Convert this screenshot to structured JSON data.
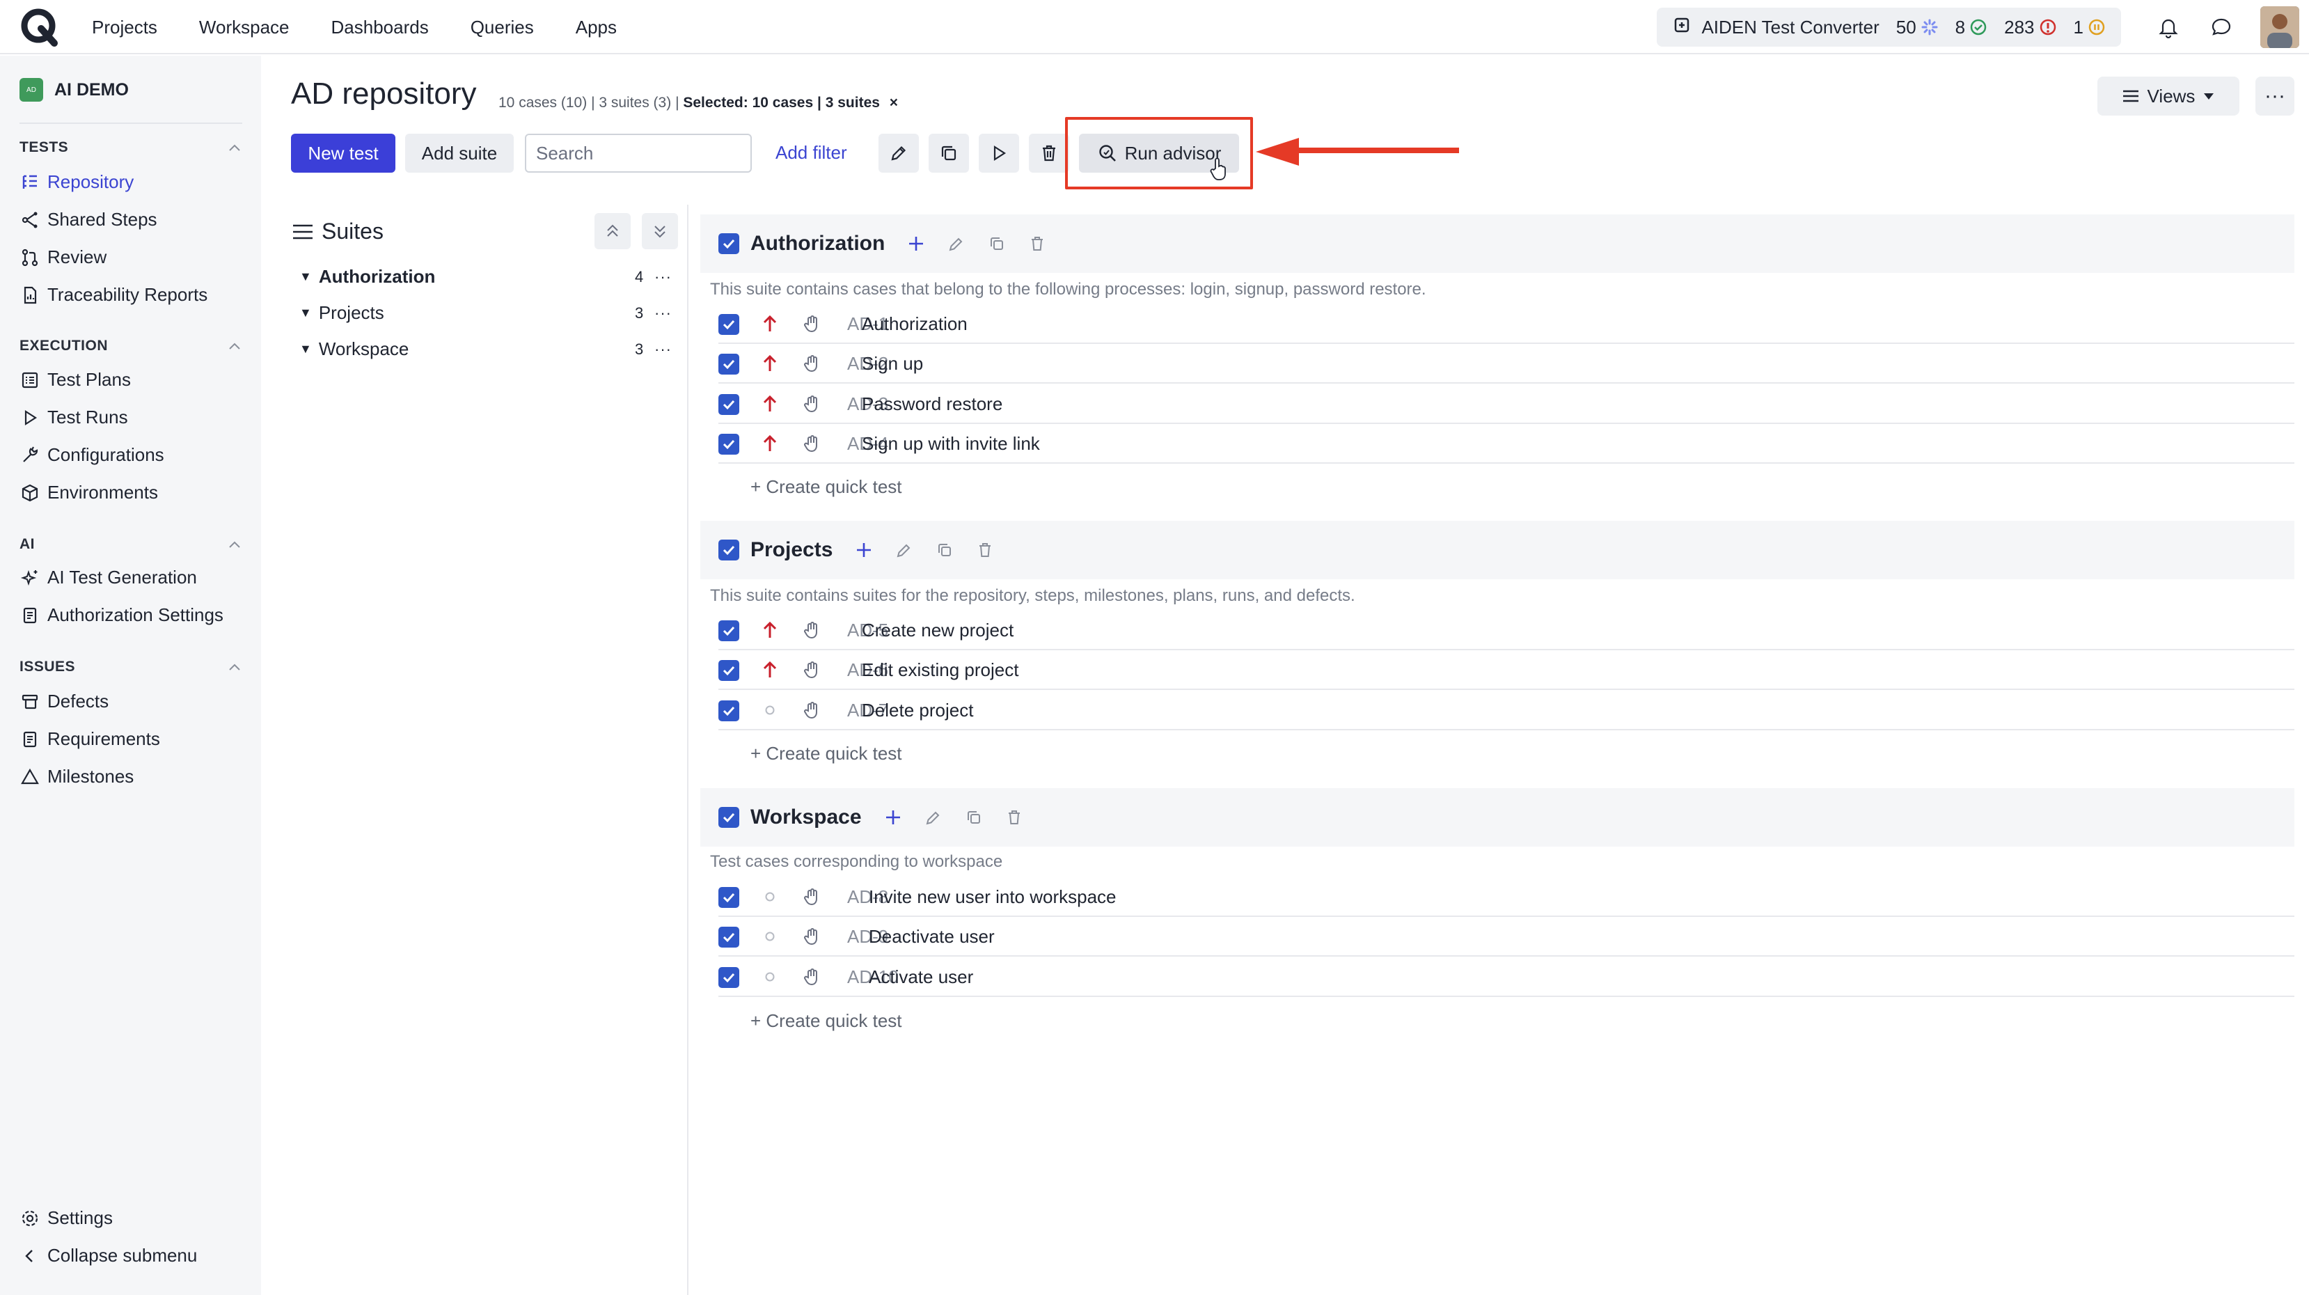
{
  "topbar": {
    "nav": [
      "Projects",
      "Workspace",
      "Dashboards",
      "Queries",
      "Apps"
    ],
    "aiden": {
      "label": "AIDEN Test Converter",
      "stat_pending": "50",
      "stat_passed": "8",
      "stat_failed": "283",
      "stat_paused": "1"
    }
  },
  "sidebar": {
    "project_badge": "AD",
    "project_name": "AI DEMO",
    "sections": {
      "tests": "TESTS",
      "execution": "EXECUTION",
      "ai": "AI",
      "issues": "ISSUES"
    },
    "items": {
      "repository": "Repository",
      "shared_steps": "Shared Steps",
      "review": "Review",
      "traceability": "Traceability Reports",
      "test_plans": "Test Plans",
      "test_runs": "Test Runs",
      "configurations": "Configurations",
      "environments": "Environments",
      "ai_test_generation": "AI Test Generation",
      "authorization_settings": "Authorization Settings",
      "defects": "Defects",
      "requirements": "Requirements",
      "milestones": "Milestones",
      "settings": "Settings",
      "collapse": "Collapse submenu"
    }
  },
  "header": {
    "title": "AD repository",
    "meta_counts": "10 cases (10) | 3 suites (3)",
    "meta_selected": "Selected: 10 cases | 3 suites",
    "meta_clear": "×",
    "views_label": "Views",
    "more_label": "···"
  },
  "toolbar": {
    "new_test": "New test",
    "add_suite": "Add suite",
    "search_placeholder": "Search",
    "add_filter": "Add filter",
    "run_advisor": "Run advisor"
  },
  "tree": {
    "title": "Suites",
    "items": [
      {
        "label": "Authorization",
        "count": "4"
      },
      {
        "label": "Projects",
        "count": "3"
      },
      {
        "label": "Workspace",
        "count": "3"
      }
    ],
    "dots": "···"
  },
  "suites": [
    {
      "name": "Authorization",
      "description": "This suite contains cases that belong to the following processes: login, signup, password restore.",
      "cases": [
        {
          "id": "AD-1",
          "title": "Authorization",
          "priority": "high"
        },
        {
          "id": "AD-2",
          "title": "Sign up",
          "priority": "high"
        },
        {
          "id": "AD-3",
          "title": "Password restore",
          "priority": "high"
        },
        {
          "id": "AD-4",
          "title": "Sign up with invite link",
          "priority": "high"
        }
      ],
      "quick": "+ Create quick test"
    },
    {
      "name": "Projects",
      "description": "This suite contains suites for the repository, steps, milestones, plans, runs, and defects.",
      "cases": [
        {
          "id": "AD-5",
          "title": "Create new project",
          "priority": "high"
        },
        {
          "id": "AD-6",
          "title": "Edit existing project",
          "priority": "high"
        },
        {
          "id": "AD-7",
          "title": "Delete project",
          "priority": "none"
        }
      ],
      "quick": "+ Create quick test"
    },
    {
      "name": "Workspace",
      "description": "Test cases corresponding to workspace",
      "cases": [
        {
          "id": "AD-8",
          "title": "Invite new user into workspace",
          "priority": "none"
        },
        {
          "id": "AD-9",
          "title": "Deactivate user",
          "priority": "none"
        },
        {
          "id": "AD-10",
          "title": "Activate user",
          "priority": "none"
        }
      ],
      "quick": "+ Create quick test"
    }
  ],
  "colors": {
    "accent": "#3b3fd8",
    "link": "#3b44d1",
    "checkbox": "#2f57c8",
    "priority_high": "#c8202c",
    "annotation_red": "#e53a26"
  }
}
